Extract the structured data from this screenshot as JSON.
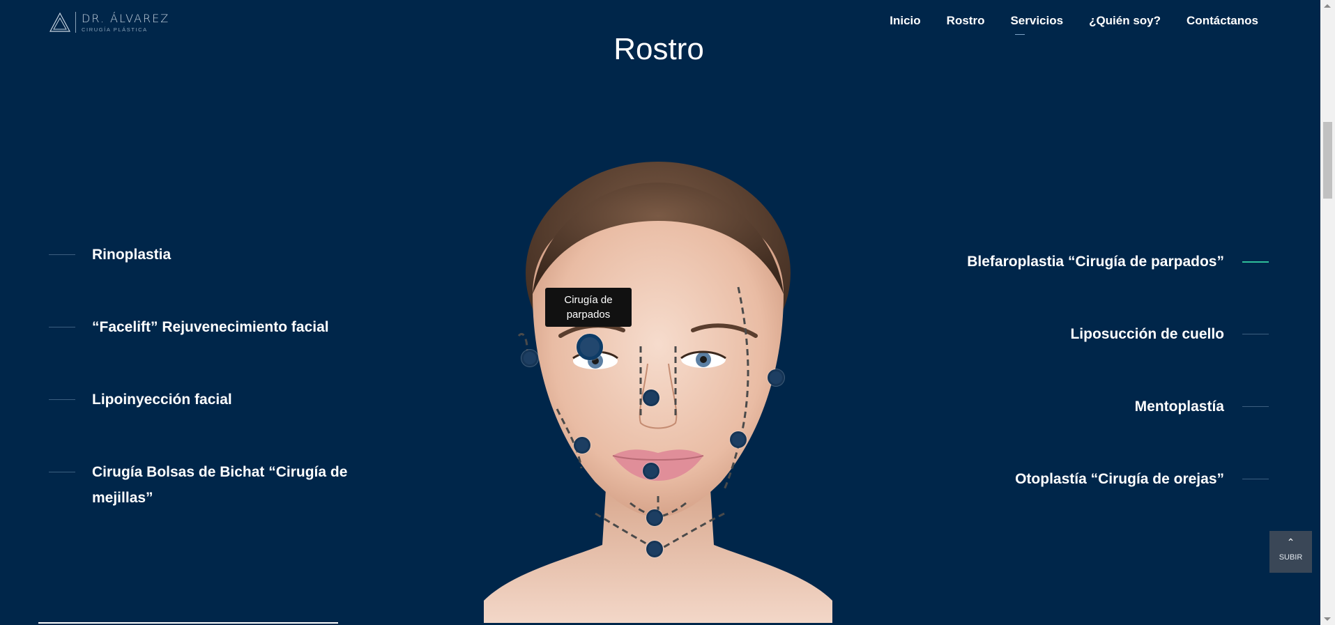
{
  "header": {
    "logo_title": "DR. ÁLVAREZ",
    "logo_subtitle": "CIRUGÍA PLÁSTICA",
    "nav": [
      {
        "label": "Inicio"
      },
      {
        "label": "Rostro"
      },
      {
        "label": "Servicios"
      },
      {
        "label": "¿Quién soy?"
      },
      {
        "label": "Contáctanos"
      }
    ]
  },
  "section": {
    "title": "Rostro"
  },
  "procedures_left": [
    {
      "label": "Rinoplastia"
    },
    {
      "label": "“Facelift” Rejuvenecimiento facial"
    },
    {
      "label": "Lipoinyección facial"
    },
    {
      "label": "Cirugía Bolsas de Bichat “Cirugía de mejillas”"
    }
  ],
  "procedures_right": [
    {
      "label": "Blefaroplastia “Cirugía de parpados”",
      "active": true
    },
    {
      "label": "Liposucción de cuello"
    },
    {
      "label": "Mentoplastía"
    },
    {
      "label": "Otoplastía “Cirugía de orejas”"
    }
  ],
  "tooltip": {
    "text": "Cirugía de parpados"
  },
  "back_to_top": {
    "label": "SUBIR"
  },
  "colors": {
    "background": "#00264a",
    "accent": "#2fbf9a",
    "tooltip_bg": "#111111"
  },
  "icons": {
    "logo": "triangle-logo-icon",
    "back_to_top": "chevron-up-icon"
  }
}
